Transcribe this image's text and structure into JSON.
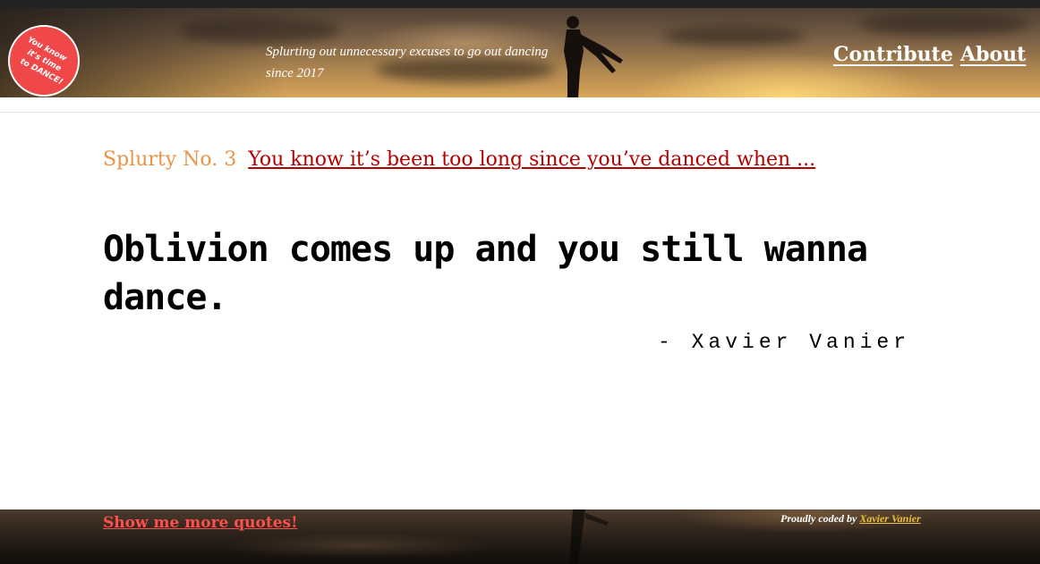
{
  "badge": {
    "line1": "You know",
    "line2": "it's time",
    "line3": "to DANCE!"
  },
  "header": {
    "tagline_line1": "Splurting out unnecessary excuses to go out dancing",
    "tagline_line2": "since 2017"
  },
  "nav": {
    "contribute_label": "Contribute",
    "about_label": "About"
  },
  "splurty": {
    "number_label": "Splurty No. 3",
    "link_text": "You know it’s been too long since you’ve danced when ..."
  },
  "quote": {
    "text": "Oblivion comes up and you still wanna dance.",
    "author": "- Xavier Vanier"
  },
  "footer": {
    "more_quotes_label": "Show me more quotes!",
    "credit_prefix": "Proudly coded by",
    "credit_name": "Xavier Vanier"
  },
  "colors": {
    "badge_red": "#f04848",
    "splurty_orange": "#e8954a",
    "link_red": "#b50000",
    "more_quotes_red": "#ff4f4f",
    "credit_gold": "#f0c040"
  }
}
